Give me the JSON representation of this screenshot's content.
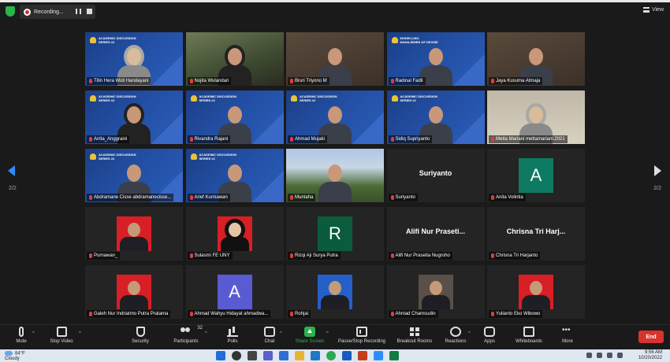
{
  "topbar": {
    "recording_label": "Recording...",
    "view_label": "View"
  },
  "pager": {
    "left": "2/2",
    "right": "2/2"
  },
  "tiles": [
    {
      "name": "Titin Hera Widi Handayani",
      "bg": "banner",
      "kind": "person",
      "style": "hijab",
      "banner_title": "ACADEMIC DISCUSSION SERIES #2"
    },
    {
      "name": "Nojita Wulandari",
      "bg": "photo",
      "kind": "person",
      "style": "darkhijab"
    },
    {
      "name": "Bruri Triyono M",
      "bg": "room",
      "kind": "person",
      "style": "plain"
    },
    {
      "name": "Radinal Fadli",
      "bg": "banner",
      "kind": "person",
      "style": "plain",
      "banner_title": "MODELLING MANAJEMEN OF DEVISE"
    },
    {
      "name": "Jaya Kusuma Atmaja",
      "bg": "room",
      "kind": "person",
      "style": "plain"
    },
    {
      "name": "Anita_Anggraini",
      "bg": "banner",
      "kind": "person",
      "style": "darkhijab",
      "banner_title": "ACADEMIC DISCUSSION SERIES #2"
    },
    {
      "name": "Rivandra Rajani",
      "bg": "banner",
      "kind": "person",
      "style": "plain",
      "banner_title": "ACADEMIC DISCUSSION SERIES #2"
    },
    {
      "name": "Ahmad Mujaki",
      "bg": "banner",
      "kind": "person",
      "style": "plain",
      "banner_title": "ACADEMIC DISCUSSION SERIES #2"
    },
    {
      "name": "Sidiq Supriyanto",
      "bg": "banner",
      "kind": "person",
      "style": "plain",
      "banner_title": "ACADEMIC DISCUSSION SERIES #2"
    },
    {
      "name": "Metta Mariani mettamariani.2021",
      "bg": "wall",
      "kind": "person",
      "style": "hijab"
    },
    {
      "name": "Abdramane Cisse abdramanecisse...",
      "bg": "banner",
      "kind": "person",
      "style": "plain",
      "banner_title": "ACADEMIC DISCUSSION SERIES #2"
    },
    {
      "name": "Arief Kurniawan",
      "bg": "banner",
      "kind": "person",
      "style": "plain",
      "banner_title": "ACADEMIC DISCUSSION SERIES #2"
    },
    {
      "name": "Muntaha",
      "bg": "outdoor",
      "kind": "person",
      "style": "plain"
    },
    {
      "name": "Suriyanto",
      "bg": "dark",
      "kind": "bigname",
      "big": "Suriyanto"
    },
    {
      "name": "Anita Volintia",
      "bg": "dark",
      "kind": "avatar",
      "letter": "A",
      "avatar_color": "teal"
    },
    {
      "name": "Purnawan_",
      "bg": "dark",
      "kind": "pic",
      "pic": "red"
    },
    {
      "name": "Sulasmi FE UNY",
      "bg": "dark",
      "kind": "pic",
      "pic": "red-hijab"
    },
    {
      "name": "Rizqi Aji Surya Putra",
      "bg": "dark",
      "kind": "avatar",
      "letter": "R",
      "avatar_color": "green"
    },
    {
      "name": "Alifi Nur Prasetia Nugroho",
      "bg": "dark",
      "kind": "bigname",
      "big": "Alifi Nur Praseti..."
    },
    {
      "name": "Chrisna Tri Harjanto",
      "bg": "dark",
      "kind": "bigname",
      "big": "Chrisna Tri Harj..."
    },
    {
      "name": "Galeh Nur Indriatmo Putra Pratama",
      "bg": "dark",
      "kind": "pic",
      "pic": "red"
    },
    {
      "name": "Ahmad Wahyu Hidayat ahmadwa...",
      "bg": "dark",
      "kind": "avatar",
      "letter": "A",
      "avatar_color": "purple"
    },
    {
      "name": "Rohjai",
      "bg": "dark",
      "kind": "pic",
      "pic": "blue"
    },
    {
      "name": "Ahmad Chamsudin",
      "bg": "dark",
      "kind": "pic",
      "pic": "room"
    },
    {
      "name": "Yulianto Eko Wibowo",
      "bg": "dark",
      "kind": "pic",
      "pic": "red"
    }
  ],
  "toolbar": {
    "mute": "Mute",
    "stop_video": "Stop Video",
    "security": "Security",
    "participants": "Participants",
    "participants_count": "32",
    "polls": "Polls",
    "chat": "Chat",
    "share_screen": "Share Screen",
    "pause_recording": "Pause/Stop Recording",
    "breakout": "Breakout Rooms",
    "reactions": "Reactions",
    "apps": "Apps",
    "whiteboards": "Whiteboards",
    "more": "More",
    "end": "End"
  },
  "taskbar": {
    "temp": "84°F",
    "weather": "Cloudy",
    "time": "9:56 AM",
    "date": "10/20/2022"
  },
  "colors": {
    "accent": "#2d8cff",
    "end_button": "#d6342c",
    "share_green": "#2bb24c"
  }
}
